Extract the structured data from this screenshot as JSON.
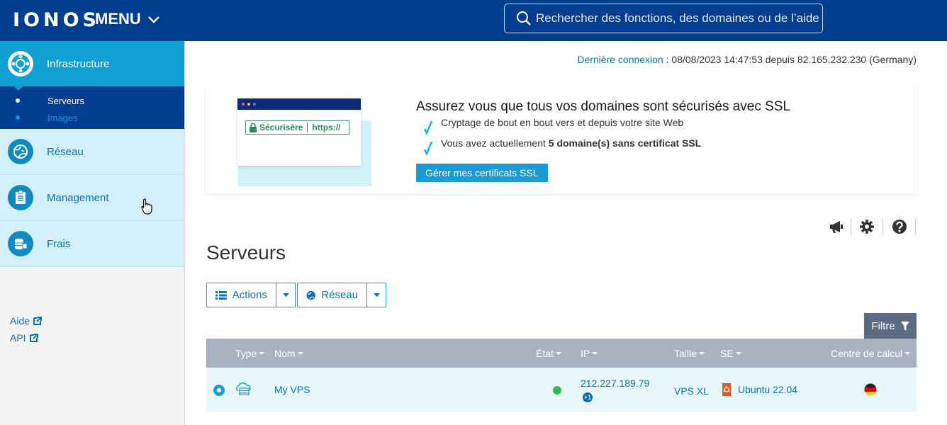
{
  "header": {
    "logo": "IONOS",
    "menu_label": "MENU",
    "search_placeholder": "Rechercher des fonctions, des domaines ou de l’aide"
  },
  "sidebar": {
    "items": [
      {
        "label": "Infrastructure",
        "icon": "network-nodes-icon",
        "active": true
      },
      {
        "label": "Réseau",
        "icon": "globe-icon"
      },
      {
        "label": "Management",
        "icon": "clipboard-icon"
      },
      {
        "label": "Frais",
        "icon": "coins-icon"
      }
    ],
    "submenu": [
      {
        "label": "Serveurs",
        "active": true
      },
      {
        "label": "Images",
        "active": false
      }
    ],
    "links": [
      {
        "label": "Aide"
      },
      {
        "label": "API"
      }
    ]
  },
  "last_login": {
    "link": "Dernière connexion",
    "text": " : 08/08/2023 14:47:53 depuis 82.165.232.230 (Germany)"
  },
  "banner": {
    "title": "Assurez vous que tous vos domaines sont sécurisés avec SSL",
    "line1": "Cryptage de bout en bout vers et depuis votre site Web",
    "line2_prefix": "Vous avez actuellement ",
    "line2_bold": "5 domaine(s) sans certificat SSL",
    "button": "Gérer mes certificats SSL",
    "illus_secure": "Sécurisère",
    "illus_https": "https://"
  },
  "page_title": "Serveurs",
  "toolbar": {
    "actions_label": "Actions",
    "network_label": "Réseau",
    "filter_label": "Filtre"
  },
  "table": {
    "headers": {
      "type": "Type",
      "name": "Nom",
      "state": "État",
      "ip": "IP",
      "size": "Taille",
      "os": "SE",
      "datacenter": "Centre de calcul"
    },
    "rows": [
      {
        "name": "My VPS",
        "state": "running",
        "ip": "212.227.189.79",
        "ip_extra": "+1",
        "size": "VPS XL",
        "os": "Ubuntu 22.04",
        "datacenter_flag": "germany-flag-icon"
      }
    ]
  },
  "colors": {
    "header_bg": "#003d8f",
    "accent": "#1a9bd7",
    "link": "#0a72b0",
    "status_green": "#2fc04f"
  }
}
